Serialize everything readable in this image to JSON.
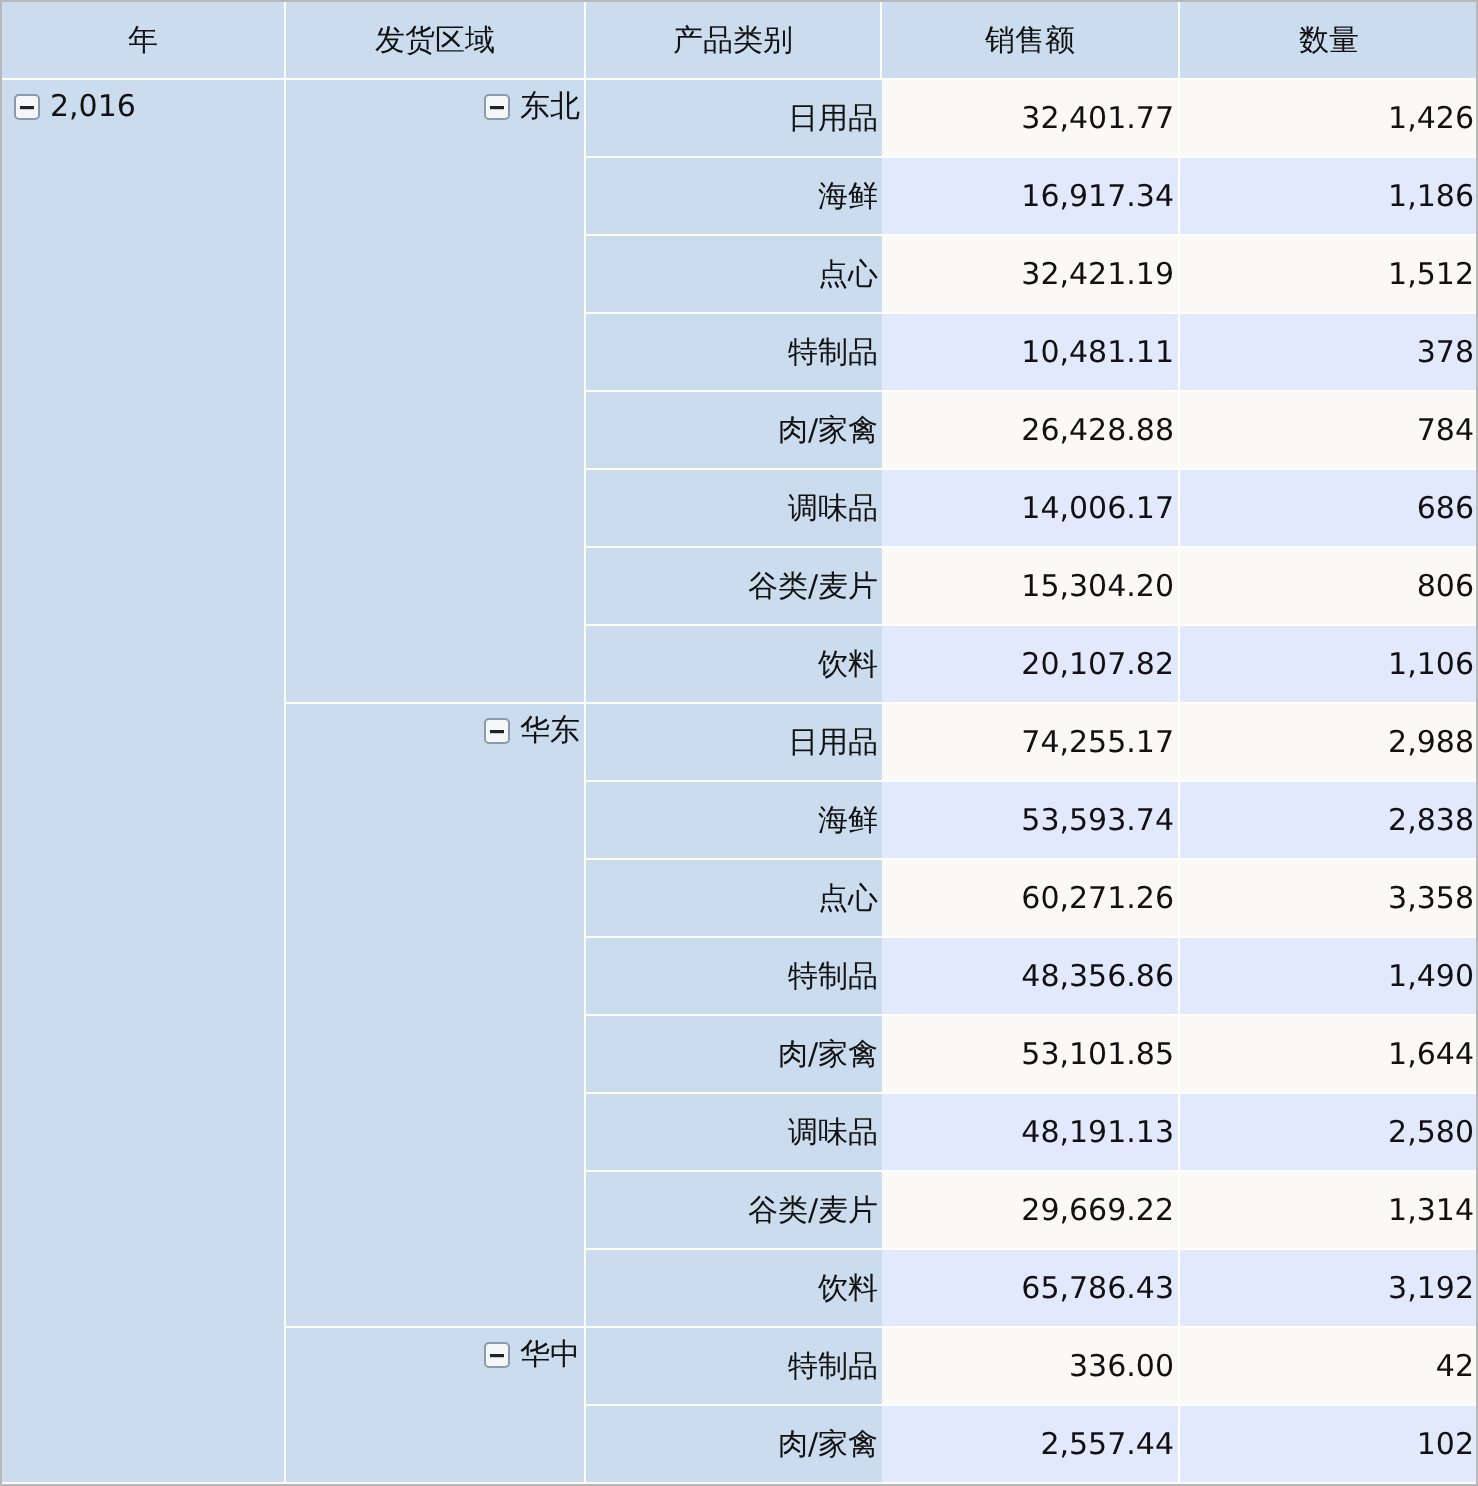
{
  "columns": [
    "年",
    "发货区域",
    "产品类别",
    "销售额",
    "数量"
  ],
  "years": [
    {
      "label": "2,016",
      "expanded": true,
      "regions": [
        {
          "label": "东北",
          "expanded": true,
          "rows": [
            {
              "category": "日用品",
              "sales": "32,401.77",
              "qty": "1,426"
            },
            {
              "category": "海鲜",
              "sales": "16,917.34",
              "qty": "1,186"
            },
            {
              "category": "点心",
              "sales": "32,421.19",
              "qty": "1,512"
            },
            {
              "category": "特制品",
              "sales": "10,481.11",
              "qty": "378"
            },
            {
              "category": "肉/家禽",
              "sales": "26,428.88",
              "qty": "784"
            },
            {
              "category": "调味品",
              "sales": "14,006.17",
              "qty": "686"
            },
            {
              "category": "谷类/麦片",
              "sales": "15,304.20",
              "qty": "806"
            },
            {
              "category": "饮料",
              "sales": "20,107.82",
              "qty": "1,106"
            }
          ]
        },
        {
          "label": "华东",
          "expanded": true,
          "rows": [
            {
              "category": "日用品",
              "sales": "74,255.17",
              "qty": "2,988"
            },
            {
              "category": "海鲜",
              "sales": "53,593.74",
              "qty": "2,838"
            },
            {
              "category": "点心",
              "sales": "60,271.26",
              "qty": "3,358"
            },
            {
              "category": "特制品",
              "sales": "48,356.86",
              "qty": "1,490"
            },
            {
              "category": "肉/家禽",
              "sales": "53,101.85",
              "qty": "1,644"
            },
            {
              "category": "调味品",
              "sales": "48,191.13",
              "qty": "2,580"
            },
            {
              "category": "谷类/麦片",
              "sales": "29,669.22",
              "qty": "1,314"
            },
            {
              "category": "饮料",
              "sales": "65,786.43",
              "qty": "3,192"
            }
          ]
        },
        {
          "label": "华中",
          "expanded": true,
          "rows": [
            {
              "category": "特制品",
              "sales": "336.00",
              "qty": "42"
            },
            {
              "category": "肉/家禽",
              "sales": "2,557.44",
              "qty": "102"
            }
          ]
        }
      ]
    }
  ]
}
